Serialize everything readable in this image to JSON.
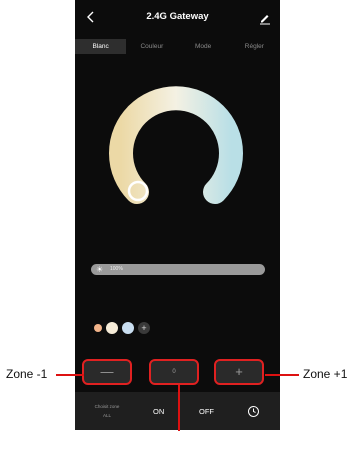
{
  "header": {
    "title": "2.4G Gateway"
  },
  "tabs": [
    {
      "label": "Blanc",
      "active": true
    },
    {
      "label": "Couleur",
      "active": false
    },
    {
      "label": "Mode",
      "active": false
    },
    {
      "label": "Régler",
      "active": false
    }
  ],
  "brightness": {
    "label": "100%",
    "value_percent": 100
  },
  "presets": {
    "colors": [
      "#f2b48a",
      "#f6ecd8",
      "#c9def0"
    ],
    "add_label": "+"
  },
  "zone_controls": {
    "minus_label": "—",
    "value": "0",
    "plus_label": "+"
  },
  "bottom_bar": {
    "zone_title": "Choisit zone",
    "zone_value": "ALL",
    "on_label": "ON",
    "off_label": "OFF"
  },
  "annotations": {
    "left": "Zone -1",
    "right": "Zone +1"
  },
  "colors": {
    "highlight": "#e02121",
    "background": "#0c0c0c"
  }
}
